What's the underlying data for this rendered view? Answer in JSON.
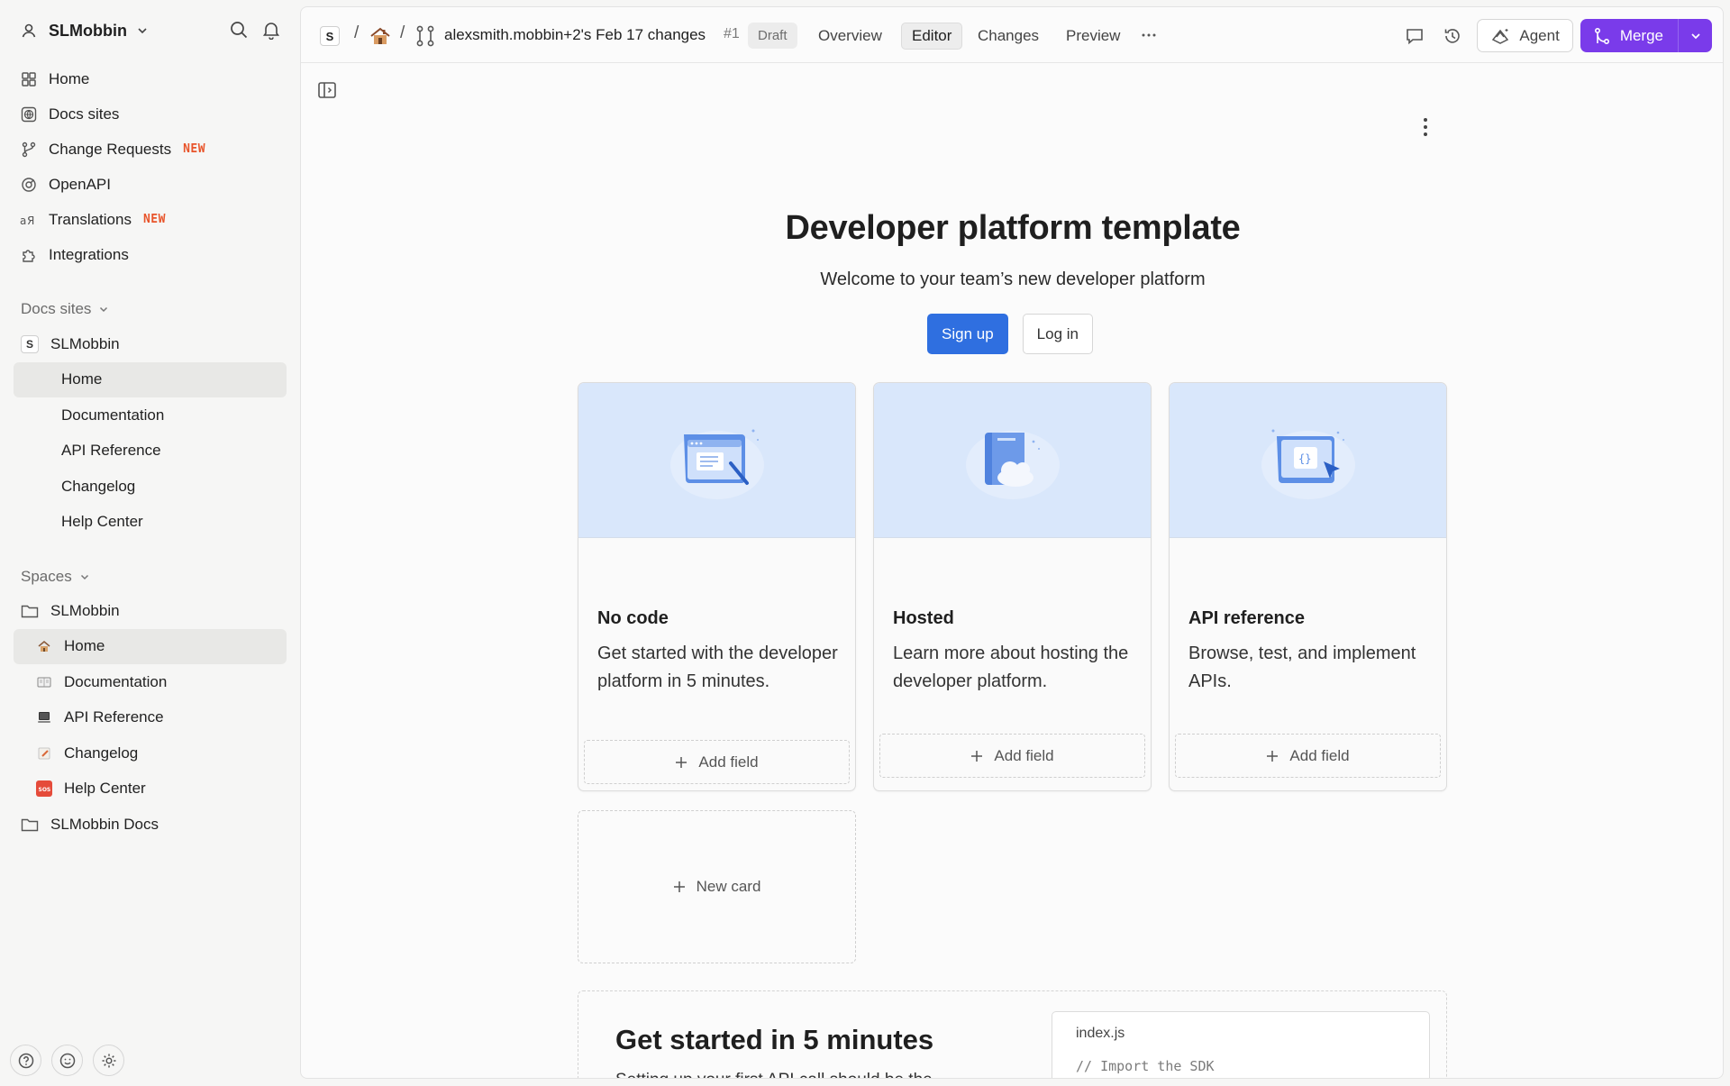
{
  "sidebar": {
    "org_name": "SLMobbin",
    "nav": [
      {
        "label": "Home",
        "icon": "grid-icon",
        "badge": ""
      },
      {
        "label": "Docs sites",
        "icon": "globe-icon",
        "badge": ""
      },
      {
        "label": "Change Requests",
        "icon": "branch-icon",
        "badge": "NEW"
      },
      {
        "label": "OpenAPI",
        "icon": "openapi-icon",
        "badge": ""
      },
      {
        "label": "Translations",
        "icon": "translate-icon",
        "badge": "NEW"
      },
      {
        "label": "Integrations",
        "icon": "puzzle-icon",
        "badge": ""
      }
    ],
    "docs_sites": {
      "title": "Docs sites",
      "root": {
        "label": "SLMobbin",
        "icon_letter": "S"
      },
      "items": [
        "Home",
        "Documentation",
        "API Reference",
        "Changelog",
        "Help Center"
      ]
    },
    "spaces": {
      "title": "Spaces",
      "root": "SLMobbin",
      "items": [
        "Home",
        "Documentation",
        "API Reference",
        "Changelog",
        "Help Center"
      ],
      "other": "SLMobbin Docs"
    }
  },
  "topbar": {
    "space_letter": "S",
    "separator": "/",
    "branch_name": "alexsmith.mobbin+2's Feb 17 changes",
    "pr_number": "#1",
    "status": "Draft",
    "tabs": [
      "Overview",
      "Editor",
      "Changes",
      "Preview"
    ],
    "active_tab": "Editor",
    "agent_label": "Agent",
    "merge_label": "Merge",
    "accent_color": "#7a3bea"
  },
  "page": {
    "title": "Developer platform template",
    "subtitle": "Welcome to your team’s new developer platform",
    "signup_label": "Sign up",
    "login_label": "Log in",
    "cards": [
      {
        "title": "No code",
        "description": "Get started with the developer platform in 5 minutes.",
        "add_label": "Add field"
      },
      {
        "title": "Hosted",
        "description": "Learn more about hosting the developer platform.",
        "add_label": "Add field"
      },
      {
        "title": "API reference",
        "description": "Browse, test, and implement APIs.",
        "add_label": "Add field"
      }
    ],
    "new_card_label": "New card",
    "getstarted": {
      "title": "Get started in 5 minutes",
      "body": "Setting up your first API call should be the",
      "code_file": "index.js",
      "code_line": "// Import the SDK"
    }
  }
}
